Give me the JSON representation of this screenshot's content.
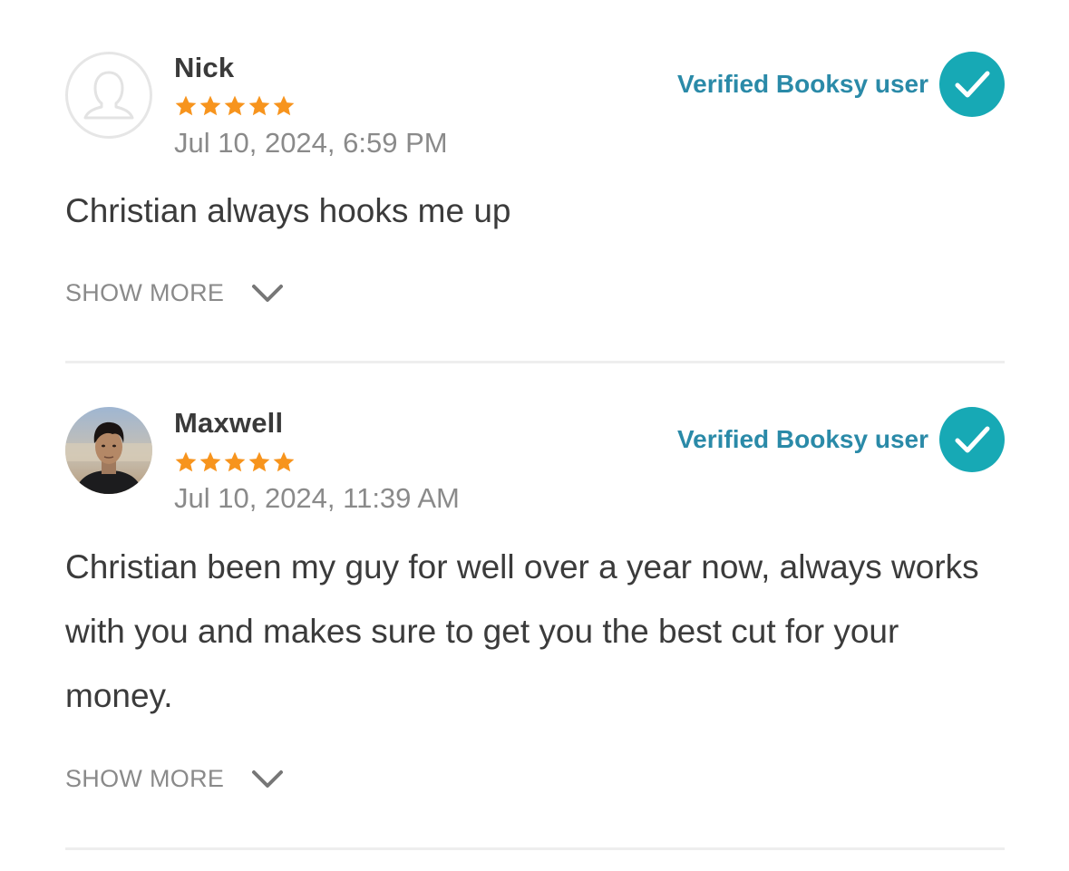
{
  "reviews": [
    {
      "name": "Nick",
      "rating": 5,
      "date": "Jul 10, 2024, 6:59 PM",
      "verified_label": "Verified Booksy user",
      "text": "Christian always hooks me up",
      "show_more": "SHOW MORE",
      "avatar": "default-user-icon"
    },
    {
      "name": "Maxwell",
      "rating": 5,
      "date": "Jul 10, 2024, 11:39 AM",
      "verified_label": "Verified Booksy user",
      "text": "Christian been my guy for well over a year now, always works with you and makes sure to get you the best cut for your money.",
      "show_more": "SHOW MORE",
      "avatar": "user-photo"
    }
  ],
  "colors": {
    "star": "#f7941d",
    "verified_text": "#2a8aa8",
    "verified_badge": "#17a9b5",
    "body_text": "#3b3b3b",
    "muted_text": "#8a8a8a",
    "divider": "#eeeeee"
  }
}
